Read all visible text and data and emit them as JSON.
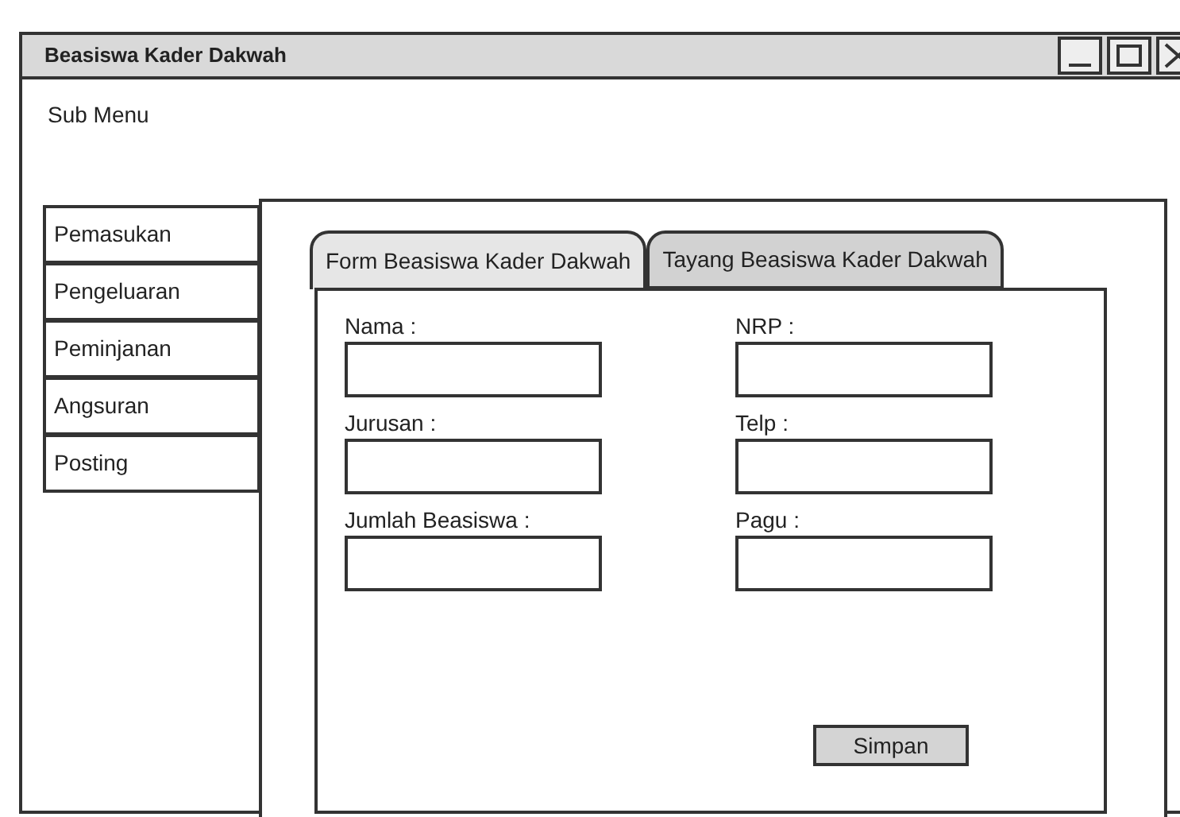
{
  "window": {
    "title": "Beasiswa Kader Dakwah"
  },
  "sub_menu": {
    "label": "Sub Menu"
  },
  "sidebar": {
    "items": [
      {
        "label": "Pemasukan"
      },
      {
        "label": "Pengeluaran"
      },
      {
        "label": "Peminjanan"
      },
      {
        "label": "Angsuran"
      },
      {
        "label": "Posting"
      }
    ]
  },
  "tabs": [
    {
      "label": "Form Beasiswa Kader Dakwah",
      "selected": true
    },
    {
      "label": "Tayang Beasiswa Kader Dakwah",
      "selected": false
    }
  ],
  "form": {
    "fields": [
      {
        "label": "Nama :"
      },
      {
        "label": "NRP :"
      },
      {
        "label": "Jurusan :"
      },
      {
        "label": "Telp :"
      },
      {
        "label": "Jumlah Beasiswa :"
      },
      {
        "label": "Pagu :"
      }
    ],
    "buttons": [
      "Simpan"
    ]
  }
}
